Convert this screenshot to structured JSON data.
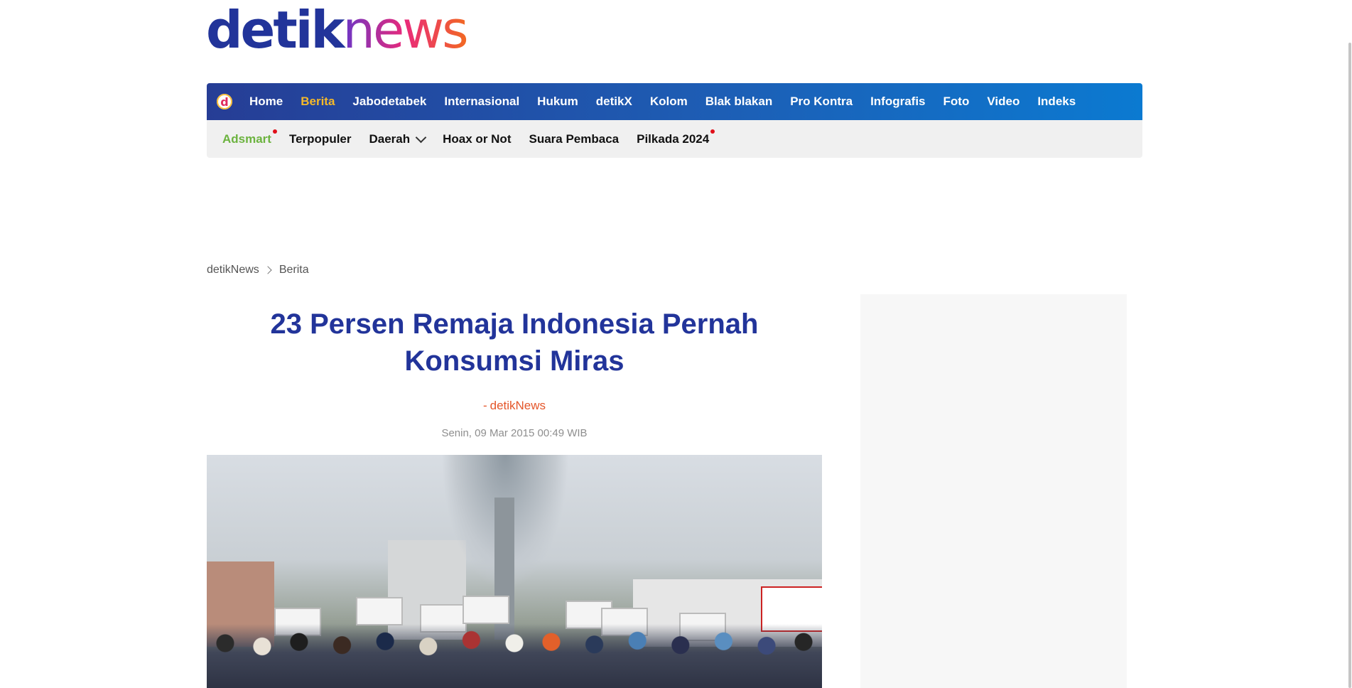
{
  "brand": {
    "logo_part1": "detik",
    "logo_part2": "news",
    "nav_logo_letter": "d"
  },
  "colors": {
    "brand_blue": "#22349a",
    "nav_gradient_start": "#263d95",
    "nav_gradient_end": "#0b7ad1",
    "active_nav": "#f5b92a",
    "author_orange": "#e4562a",
    "green_link": "#6cb33f",
    "notification_dot": "#e0101a"
  },
  "nav_primary": {
    "items": [
      {
        "label": "Home",
        "active": false
      },
      {
        "label": "Berita",
        "active": true
      },
      {
        "label": "Jabodetabek",
        "active": false
      },
      {
        "label": "Internasional",
        "active": false
      },
      {
        "label": "Hukum",
        "active": false
      },
      {
        "label": "detikX",
        "active": false
      },
      {
        "label": "Kolom",
        "active": false
      },
      {
        "label": "Blak blakan",
        "active": false
      },
      {
        "label": "Pro Kontra",
        "active": false
      },
      {
        "label": "Infografis",
        "active": false
      },
      {
        "label": "Foto",
        "active": false
      },
      {
        "label": "Video",
        "active": false
      },
      {
        "label": "Indeks",
        "active": false
      }
    ]
  },
  "nav_secondary": {
    "items": [
      {
        "label": "Adsmart",
        "has_dot": true
      },
      {
        "label": "Terpopuler",
        "has_dot": false
      },
      {
        "label": "Daerah",
        "has_dropdown": true
      },
      {
        "label": "Hoax or Not",
        "has_dot": false
      },
      {
        "label": "Suara Pembaca",
        "has_dot": false
      },
      {
        "label": "Pilkada 2024",
        "has_dot": true
      }
    ]
  },
  "breadcrumb": {
    "items": [
      "detikNews",
      "Berita"
    ]
  },
  "article": {
    "title": "23 Persen Remaja Indonesia Pernah Konsumsi Miras",
    "author_prefix": "-",
    "author": "detikNews",
    "date": "Senin, 09 Mar 2015 00:49 WIB"
  },
  "icons": {
    "breadcrumb_separator": "chevron-right-icon",
    "dropdown": "chevron-down-icon"
  }
}
